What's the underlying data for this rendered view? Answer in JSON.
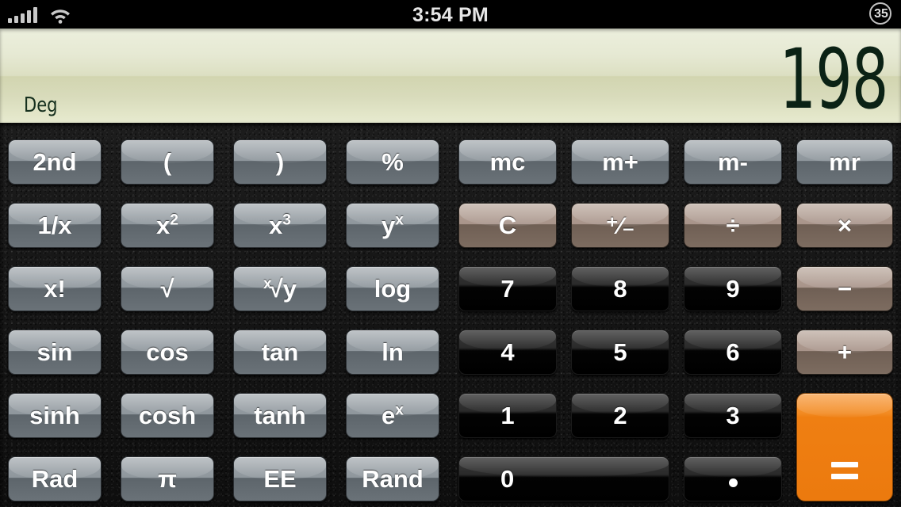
{
  "status_bar": {
    "signal_icon": "cellular-signal-icon",
    "signal_bars": 5,
    "wifi_icon": "wifi-icon",
    "time": "3:54 PM",
    "battery_icon": "battery-percent-ring-icon",
    "battery_percent": "35"
  },
  "display": {
    "value": "198",
    "mode": "Deg",
    "text_color": "#0b2215",
    "background_color": "#e2e5cb"
  },
  "colors": {
    "function_key": "#8e969c",
    "operator_key": "#a8948a",
    "digit_key": "#000000",
    "equals_key": "#ef7f12",
    "keypad_background": "#141414"
  },
  "keypad": {
    "rows": [
      [
        {
          "name": "second",
          "label": "2nd",
          "type": "fn"
        },
        {
          "name": "open-paren",
          "label": "(",
          "type": "fn"
        },
        {
          "name": "close-paren",
          "label": ")",
          "type": "fn"
        },
        {
          "name": "percent",
          "label": "%",
          "type": "fn"
        },
        {
          "name": "memory-clear",
          "label": "mc",
          "type": "fn"
        },
        {
          "name": "memory-add",
          "label": "m+",
          "type": "fn"
        },
        {
          "name": "memory-sub",
          "label": "m-",
          "type": "fn"
        },
        {
          "name": "memory-recall",
          "label": "mr",
          "type": "fn"
        }
      ],
      [
        {
          "name": "reciprocal",
          "label": "1/x",
          "type": "fn"
        },
        {
          "name": "square",
          "label": "x2",
          "type": "fn"
        },
        {
          "name": "cube",
          "label": "x3",
          "type": "fn"
        },
        {
          "name": "power-y-x",
          "label": "yx",
          "type": "fn"
        },
        {
          "name": "clear",
          "label": "C",
          "type": "op"
        },
        {
          "name": "plus-minus",
          "label": "+/-",
          "type": "op"
        },
        {
          "name": "divide",
          "label": "÷",
          "type": "op"
        },
        {
          "name": "multiply",
          "label": "×",
          "type": "op"
        }
      ],
      [
        {
          "name": "factorial",
          "label": "x!",
          "type": "fn"
        },
        {
          "name": "square-root",
          "label": "√",
          "type": "fn"
        },
        {
          "name": "xth-root",
          "label": "x√y",
          "type": "fn"
        },
        {
          "name": "log",
          "label": "log",
          "type": "fn"
        },
        {
          "name": "seven",
          "label": "7",
          "type": "digit"
        },
        {
          "name": "eight",
          "label": "8",
          "type": "digit"
        },
        {
          "name": "nine",
          "label": "9",
          "type": "digit"
        },
        {
          "name": "subtract",
          "label": "−",
          "type": "op"
        }
      ],
      [
        {
          "name": "sin",
          "label": "sin",
          "type": "fn"
        },
        {
          "name": "cos",
          "label": "cos",
          "type": "fn"
        },
        {
          "name": "tan",
          "label": "tan",
          "type": "fn"
        },
        {
          "name": "natural-log",
          "label": "ln",
          "type": "fn"
        },
        {
          "name": "four",
          "label": "4",
          "type": "digit"
        },
        {
          "name": "five",
          "label": "5",
          "type": "digit"
        },
        {
          "name": "six",
          "label": "6",
          "type": "digit"
        },
        {
          "name": "add",
          "label": "+",
          "type": "op"
        }
      ],
      [
        {
          "name": "sinh",
          "label": "sinh",
          "type": "fn"
        },
        {
          "name": "cosh",
          "label": "cosh",
          "type": "fn"
        },
        {
          "name": "tanh",
          "label": "tanh",
          "type": "fn"
        },
        {
          "name": "exp",
          "label": "ex",
          "type": "fn"
        },
        {
          "name": "one",
          "label": "1",
          "type": "digit"
        },
        {
          "name": "two",
          "label": "2",
          "type": "digit"
        },
        {
          "name": "three",
          "label": "3",
          "type": "digit"
        },
        {
          "name": "equals",
          "label": "=",
          "type": "equals"
        }
      ],
      [
        {
          "name": "rad",
          "label": "Rad",
          "type": "fn"
        },
        {
          "name": "pi",
          "label": "π",
          "type": "fn"
        },
        {
          "name": "ee",
          "label": "EE",
          "type": "fn"
        },
        {
          "name": "rand",
          "label": "Rand",
          "type": "fn"
        },
        {
          "name": "zero",
          "label": "0",
          "type": "digit"
        },
        {
          "name": "decimal",
          "label": ".",
          "type": "digit"
        }
      ]
    ]
  }
}
